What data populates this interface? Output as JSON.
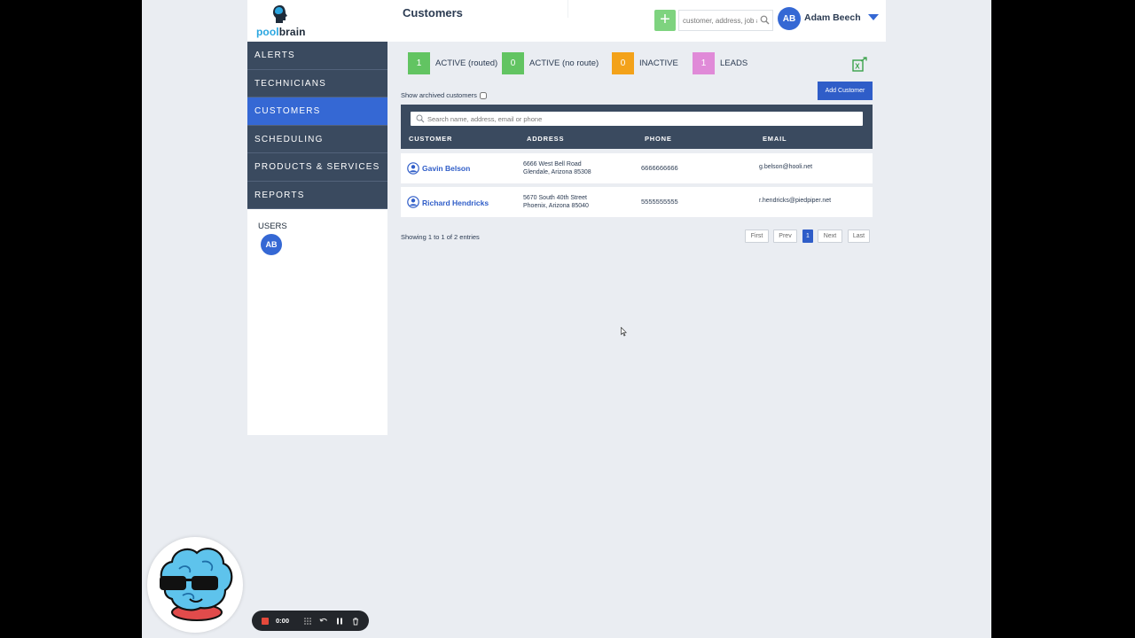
{
  "sidebar": {
    "logo": {
      "pool": "pool",
      "brain": "brain"
    },
    "nav": [
      "ALERTS",
      "TECHNICIANS",
      "CUSTOMERS",
      "SCHEDULING",
      "PRODUCTS & SERVICES",
      "REPORTS"
    ],
    "active_index": 2,
    "users_label": "USERS",
    "user_initials": "AB"
  },
  "header": {
    "title": "Customers",
    "add_label": "+",
    "search_placeholder": "customer, address, job #",
    "user_initials": "AB",
    "user_name": "Adam Beech"
  },
  "stats": [
    {
      "count": "1",
      "label": "ACTIVE (routed)",
      "color": "#62c462"
    },
    {
      "count": "0",
      "label": "ACTIVE (no route)",
      "color": "#62c462"
    },
    {
      "count": "0",
      "label": "INACTIVE",
      "color": "#f3a21a"
    },
    {
      "count": "1",
      "label": "LEADS",
      "color": "#e08ad8"
    }
  ],
  "controls": {
    "show_archived": "Show archived customers",
    "add_customer": "Add Customer",
    "table_search_placeholder": "Search name, address, email or phone"
  },
  "table": {
    "headers": [
      "CUSTOMER",
      "ADDRESS",
      "PHONE",
      "EMAIL"
    ],
    "rows": [
      {
        "name": "Gavin Belson",
        "address1": "6666 West Bell Road",
        "address2": "Glendale, Arizona 85308",
        "phone": "6666666666",
        "email": "g.belson@hooli.net"
      },
      {
        "name": "Richard Hendricks",
        "address1": "5670 South 40th Street",
        "address2": "Phoenix, Arizona 85040",
        "phone": "5555555555",
        "email": "r.hendricks@piedpiper.net"
      }
    ]
  },
  "footer": {
    "showing": "Showing 1 to 1 of 2 entries",
    "pager": [
      "First",
      "Prev",
      "1",
      "Next",
      "Last"
    ]
  },
  "recorder": {
    "time": "0:00"
  }
}
